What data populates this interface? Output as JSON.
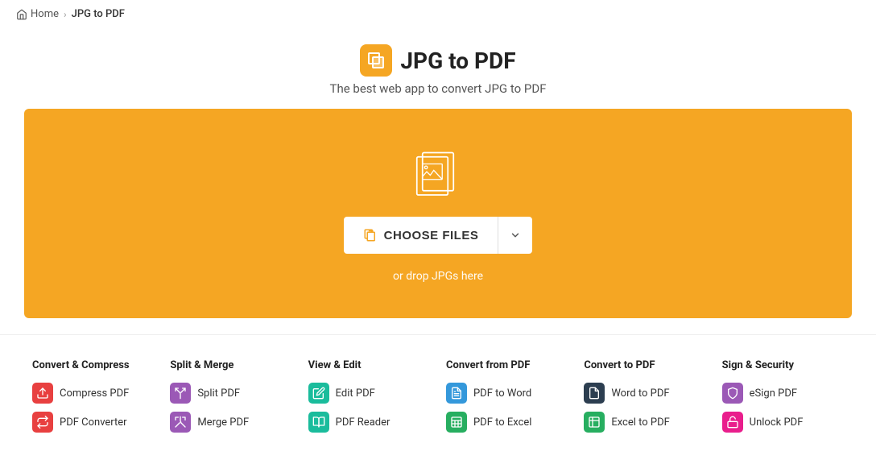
{
  "breadcrumb": {
    "home_label": "Home",
    "separator": "›",
    "current": "JPG to PDF"
  },
  "header": {
    "title": "JPG to PDF",
    "subtitle": "The best web app to convert JPG to PDF"
  },
  "drop_zone": {
    "choose_files_label": "CHOOSE FILES",
    "drop_hint": "or drop JPGs here"
  },
  "footer": {
    "categories": [
      {
        "title": "Convert & Compress",
        "links": [
          {
            "label": "Compress PDF",
            "icon": "compress",
            "color": "red"
          },
          {
            "label": "PDF Converter",
            "icon": "convert",
            "color": "red"
          }
        ]
      },
      {
        "title": "Split & Merge",
        "links": [
          {
            "label": "Split PDF",
            "icon": "split",
            "color": "purple"
          },
          {
            "label": "Merge PDF",
            "icon": "merge",
            "color": "purple"
          }
        ]
      },
      {
        "title": "View & Edit",
        "links": [
          {
            "label": "Edit PDF",
            "icon": "edit",
            "color": "teal"
          },
          {
            "label": "PDF Reader",
            "icon": "reader",
            "color": "teal"
          }
        ]
      },
      {
        "title": "Convert from PDF",
        "links": [
          {
            "label": "PDF to Word",
            "icon": "word",
            "color": "blue"
          },
          {
            "label": "PDF to Excel",
            "icon": "excel",
            "color": "green"
          }
        ]
      },
      {
        "title": "Convert to PDF",
        "links": [
          {
            "label": "Word to PDF",
            "icon": "word2",
            "color": "dark-blue"
          },
          {
            "label": "Excel to PDF",
            "icon": "excel2",
            "color": "green"
          }
        ]
      },
      {
        "title": "Sign & Security",
        "links": [
          {
            "label": "eSign PDF",
            "icon": "sign",
            "color": "purple"
          },
          {
            "label": "Unlock PDF",
            "icon": "unlock",
            "color": "pink"
          }
        ]
      }
    ]
  }
}
